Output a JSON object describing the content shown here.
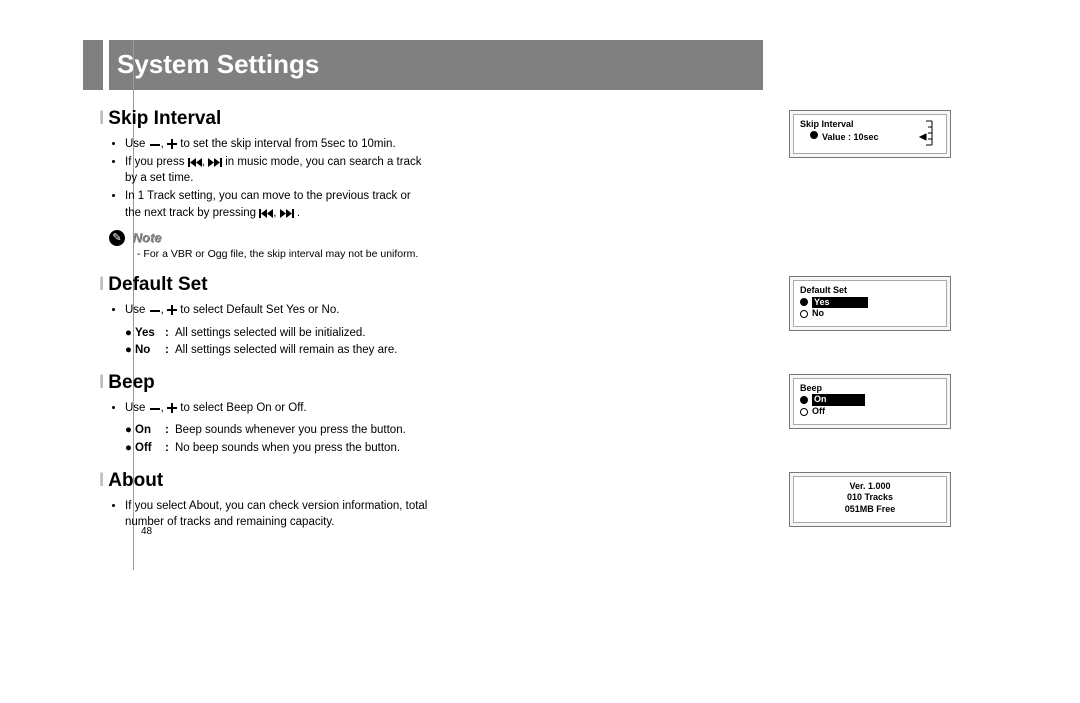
{
  "header": {
    "title": "System Settings"
  },
  "sections": {
    "skip": {
      "heading": "Skip Interval",
      "b1_pre": "Use ",
      "b1_post": " to set the skip interval from 5sec to 10min.",
      "b2_pre": "If you press ",
      "b2_post": " in music mode, you can search a track by a set time.",
      "b3_pre": "In 1 Track setting, you can move to the previous track or the next track by pressing ",
      "b3_post": ".",
      "note_label": "Note",
      "note_body": "- For a VBR or Ogg file, the skip interval may not be uniform.",
      "screen": {
        "title": "Skip Interval",
        "value_label": "Value : 10sec"
      }
    },
    "defaultset": {
      "heading": "Default Set",
      "b1_pre": "Use ",
      "b1_post": " to select Default Set Yes or No.",
      "yes_label": "Yes",
      "yes_desc": "All settings selected will be initialized.",
      "no_label": "No",
      "no_desc": "All settings selected will remain as they are.",
      "screen": {
        "title": "Default Set",
        "opt1": "Yes",
        "opt2": "No"
      }
    },
    "beep": {
      "heading": "Beep",
      "b1_pre": "Use ",
      "b1_post": " to select Beep On or Off.",
      "on_label": "On",
      "on_desc": "Beep sounds whenever you press the button.",
      "off_label": "Off",
      "off_desc": "No beep sounds when you press the button.",
      "screen": {
        "title": "Beep",
        "opt1": "On",
        "opt2": "Off"
      }
    },
    "about": {
      "heading": "About",
      "b1": "If you select About, you can check version information, total number of tracks and remaining capacity.",
      "screen": {
        "l1": "Ver.  1.000",
        "l2": "010  Tracks",
        "l3": "051MB Free"
      }
    }
  },
  "page_number": "48"
}
